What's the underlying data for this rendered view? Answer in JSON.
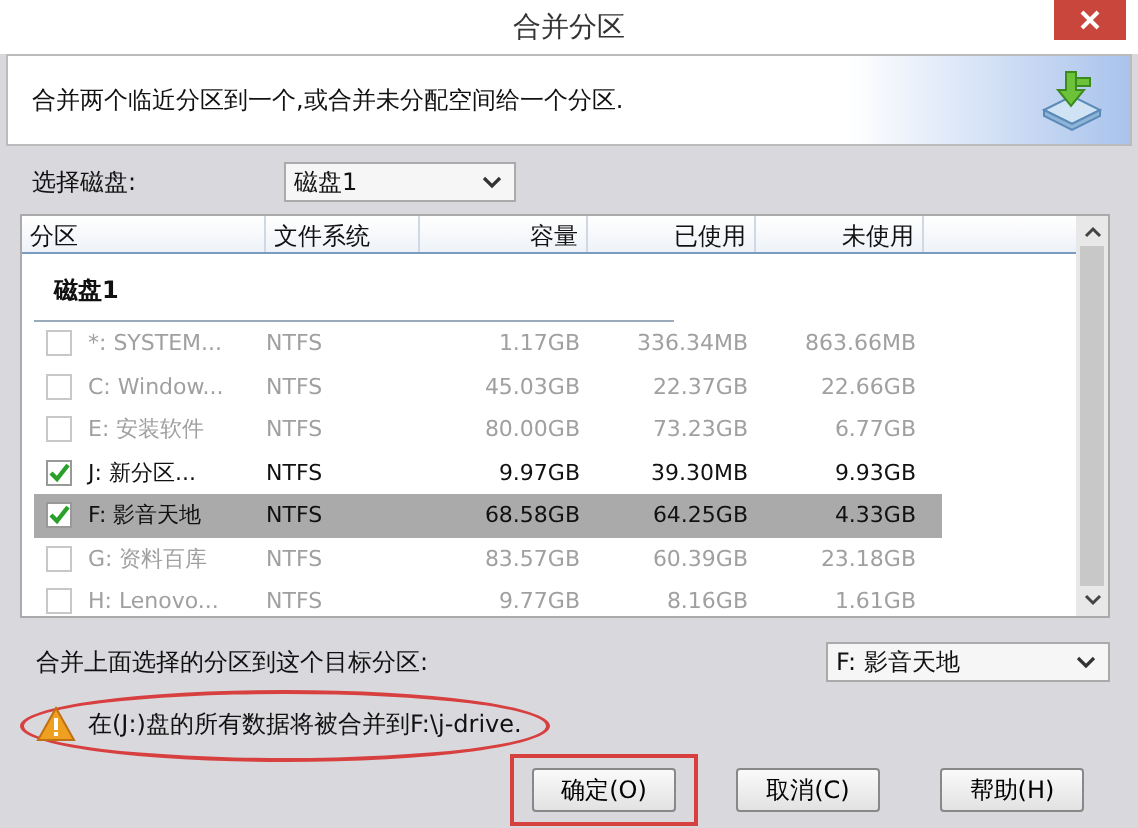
{
  "window": {
    "title": "合并分区"
  },
  "header": {
    "description": "合并两个临近分区到一个,或合并未分配空间给一个分区."
  },
  "disk_select": {
    "label": "选择磁盘:",
    "value": "磁盘1"
  },
  "table": {
    "columns": [
      "分区",
      "文件系统",
      "容量",
      "已使用",
      "未使用"
    ],
    "group": "磁盘1",
    "rows": [
      {
        "name": "*: SYSTEM...",
        "fs": "NTFS",
        "capacity": "1.17GB",
        "used": "336.34MB",
        "free": "863.66MB",
        "checked": false,
        "disabled": true,
        "selected": false
      },
      {
        "name": "C: Window...",
        "fs": "NTFS",
        "capacity": "45.03GB",
        "used": "22.37GB",
        "free": "22.66GB",
        "checked": false,
        "disabled": true,
        "selected": false
      },
      {
        "name": "E: 安装软件",
        "fs": "NTFS",
        "capacity": "80.00GB",
        "used": "73.23GB",
        "free": "6.77GB",
        "checked": false,
        "disabled": true,
        "selected": false
      },
      {
        "name": "J: 新分区...",
        "fs": "NTFS",
        "capacity": "9.97GB",
        "used": "39.30MB",
        "free": "9.93GB",
        "checked": true,
        "disabled": false,
        "selected": false
      },
      {
        "name": "F: 影音天地",
        "fs": "NTFS",
        "capacity": "68.58GB",
        "used": "64.25GB",
        "free": "4.33GB",
        "checked": true,
        "disabled": false,
        "selected": true
      },
      {
        "name": "G: 资料百库",
        "fs": "NTFS",
        "capacity": "83.57GB",
        "used": "60.39GB",
        "free": "23.18GB",
        "checked": false,
        "disabled": true,
        "selected": false
      },
      {
        "name": "H: Lenovo...",
        "fs": "NTFS",
        "capacity": "9.77GB",
        "used": "8.16GB",
        "free": "1.61GB",
        "checked": false,
        "disabled": true,
        "selected": false
      }
    ]
  },
  "target": {
    "label": "合并上面选择的分区到这个目标分区:",
    "value": "F: 影音天地"
  },
  "warning": {
    "text": "在(J:)盘的所有数据将被合并到F:\\j-drive.",
    "circled": true
  },
  "buttons": [
    {
      "label": "确定(O)",
      "highlighted": true
    },
    {
      "label": "取消(C)",
      "highlighted": false
    },
    {
      "label": "帮助(H)",
      "highlighted": false
    }
  ]
}
